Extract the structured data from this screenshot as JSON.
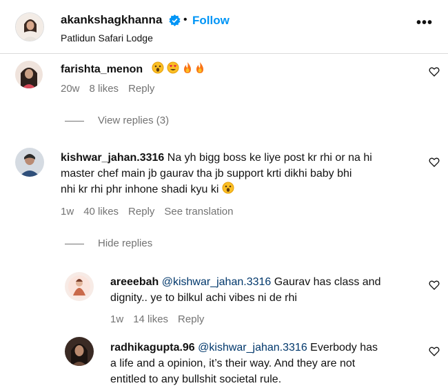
{
  "post": {
    "author": "akankshagkhanna",
    "follow_label": "Follow",
    "dot": "•",
    "location": "Patlidun Safari Lodge",
    "more": "•••"
  },
  "comments": [
    {
      "user": "farishta_menon",
      "text": "",
      "time": "20w",
      "likes": "8 likes",
      "reply": "Reply",
      "view_replies": "View replies (3)"
    },
    {
      "user": "kishwar_jahan.3316",
      "line1": "Na yh bigg boss ke liye post kr rhi or na hi",
      "line2": "master chef main jb gaurav tha jb support krti dikhi baby bhi",
      "line3": "nhi kr rhi phr inhone shadi kyu ki",
      "time": "1w",
      "likes": "40 likes",
      "reply": "Reply",
      "see_translation": "See translation",
      "hide_replies": "Hide replies"
    }
  ],
  "replies": [
    {
      "user": "areeebah",
      "mention": "@kishwar_jahan.3316",
      "line1": " Gaurav has class and",
      "line2": "dignity.. ye to bilkul achi vibes ni de rhi",
      "time": "1w",
      "likes": "14 likes",
      "reply": "Reply"
    },
    {
      "user": "radhikagupta.96",
      "mention": "@kishwar_jahan.3316",
      "line1": " Everbody has",
      "line2": "a life and a opinion, it’s their way. And they are not",
      "line3": "entitled to any bullshit societal rule."
    }
  ],
  "colors": {
    "accent": "#0095f6",
    "secondary": "#737373",
    "mention": "#00376b"
  }
}
